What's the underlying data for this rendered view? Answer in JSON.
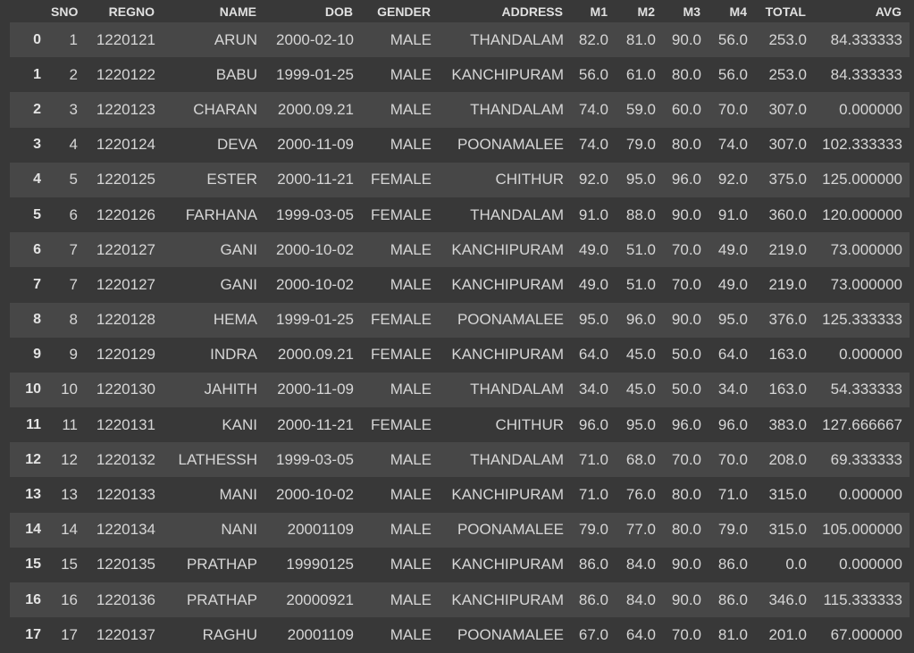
{
  "table": {
    "columns": [
      "SNO",
      "REGNO",
      "NAME",
      "DOB",
      "GENDER",
      "ADDRESS",
      "M1",
      "M2",
      "M3",
      "M4",
      "TOTAL",
      "AVG"
    ],
    "rows": [
      {
        "index": "0",
        "cells": [
          "1",
          "1220121",
          "ARUN",
          "2000-02-10",
          "MALE",
          "THANDALAM",
          "82.0",
          "81.0",
          "90.0",
          "56.0",
          "253.0",
          "84.333333"
        ]
      },
      {
        "index": "1",
        "cells": [
          "2",
          "1220122",
          "BABU",
          "1999-01-25",
          "MALE",
          "KANCHIPURAM",
          "56.0",
          "61.0",
          "80.0",
          "56.0",
          "253.0",
          "84.333333"
        ]
      },
      {
        "index": "2",
        "cells": [
          "3",
          "1220123",
          "CHARAN",
          "2000.09.21",
          "MALE",
          "THANDALAM",
          "74.0",
          "59.0",
          "60.0",
          "70.0",
          "307.0",
          "0.000000"
        ]
      },
      {
        "index": "3",
        "cells": [
          "4",
          "1220124",
          "DEVA",
          "2000-11-09",
          "MALE",
          "POONAMALEE",
          "74.0",
          "79.0",
          "80.0",
          "74.0",
          "307.0",
          "102.333333"
        ]
      },
      {
        "index": "4",
        "cells": [
          "5",
          "1220125",
          "ESTER",
          "2000-11-21",
          "FEMALE",
          "CHITHUR",
          "92.0",
          "95.0",
          "96.0",
          "92.0",
          "375.0",
          "125.000000"
        ]
      },
      {
        "index": "5",
        "cells": [
          "6",
          "1220126",
          "FARHANA",
          "1999-03-05",
          "FEMALE",
          "THANDALAM",
          "91.0",
          "88.0",
          "90.0",
          "91.0",
          "360.0",
          "120.000000"
        ]
      },
      {
        "index": "6",
        "cells": [
          "7",
          "1220127",
          "GANI",
          "2000-10-02",
          "MALE",
          "KANCHIPURAM",
          "49.0",
          "51.0",
          "70.0",
          "49.0",
          "219.0",
          "73.000000"
        ]
      },
      {
        "index": "7",
        "cells": [
          "7",
          "1220127",
          "GANI",
          "2000-10-02",
          "MALE",
          "KANCHIPURAM",
          "49.0",
          "51.0",
          "70.0",
          "49.0",
          "219.0",
          "73.000000"
        ]
      },
      {
        "index": "8",
        "cells": [
          "8",
          "1220128",
          "HEMA",
          "1999-01-25",
          "FEMALE",
          "POONAMALEE",
          "95.0",
          "96.0",
          "90.0",
          "95.0",
          "376.0",
          "125.333333"
        ]
      },
      {
        "index": "9",
        "cells": [
          "9",
          "1220129",
          "INDRA",
          "2000.09.21",
          "FEMALE",
          "KANCHIPURAM",
          "64.0",
          "45.0",
          "50.0",
          "64.0",
          "163.0",
          "0.000000"
        ]
      },
      {
        "index": "10",
        "cells": [
          "10",
          "1220130",
          "JAHITH",
          "2000-11-09",
          "MALE",
          "THANDALAM",
          "34.0",
          "45.0",
          "50.0",
          "34.0",
          "163.0",
          "54.333333"
        ]
      },
      {
        "index": "11",
        "cells": [
          "11",
          "1220131",
          "KANI",
          "2000-11-21",
          "FEMALE",
          "CHITHUR",
          "96.0",
          "95.0",
          "96.0",
          "96.0",
          "383.0",
          "127.666667"
        ]
      },
      {
        "index": "12",
        "cells": [
          "12",
          "1220132",
          "LATHESSH",
          "1999-03-05",
          "MALE",
          "THANDALAM",
          "71.0",
          "68.0",
          "70.0",
          "70.0",
          "208.0",
          "69.333333"
        ]
      },
      {
        "index": "13",
        "cells": [
          "13",
          "1220133",
          "MANI",
          "2000-10-02",
          "MALE",
          "KANCHIPURAM",
          "71.0",
          "76.0",
          "80.0",
          "71.0",
          "315.0",
          "0.000000"
        ]
      },
      {
        "index": "14",
        "cells": [
          "14",
          "1220134",
          "NANI",
          "20001109",
          "MALE",
          "POONAMALEE",
          "79.0",
          "77.0",
          "80.0",
          "79.0",
          "315.0",
          "105.000000"
        ]
      },
      {
        "index": "15",
        "cells": [
          "15",
          "1220135",
          "PRATHAP",
          "19990125",
          "MALE",
          "KANCHIPURAM",
          "86.0",
          "84.0",
          "90.0",
          "86.0",
          "0.0",
          "0.000000"
        ]
      },
      {
        "index": "16",
        "cells": [
          "16",
          "1220136",
          "PRATHAP",
          "20000921",
          "MALE",
          "KANCHIPURAM",
          "86.0",
          "84.0",
          "90.0",
          "86.0",
          "346.0",
          "115.333333"
        ]
      },
      {
        "index": "17",
        "cells": [
          "17",
          "1220137",
          "RAGHU",
          "20001109",
          "MALE",
          "POONAMALEE",
          "67.0",
          "64.0",
          "70.0",
          "81.0",
          "201.0",
          "67.000000"
        ]
      }
    ]
  }
}
